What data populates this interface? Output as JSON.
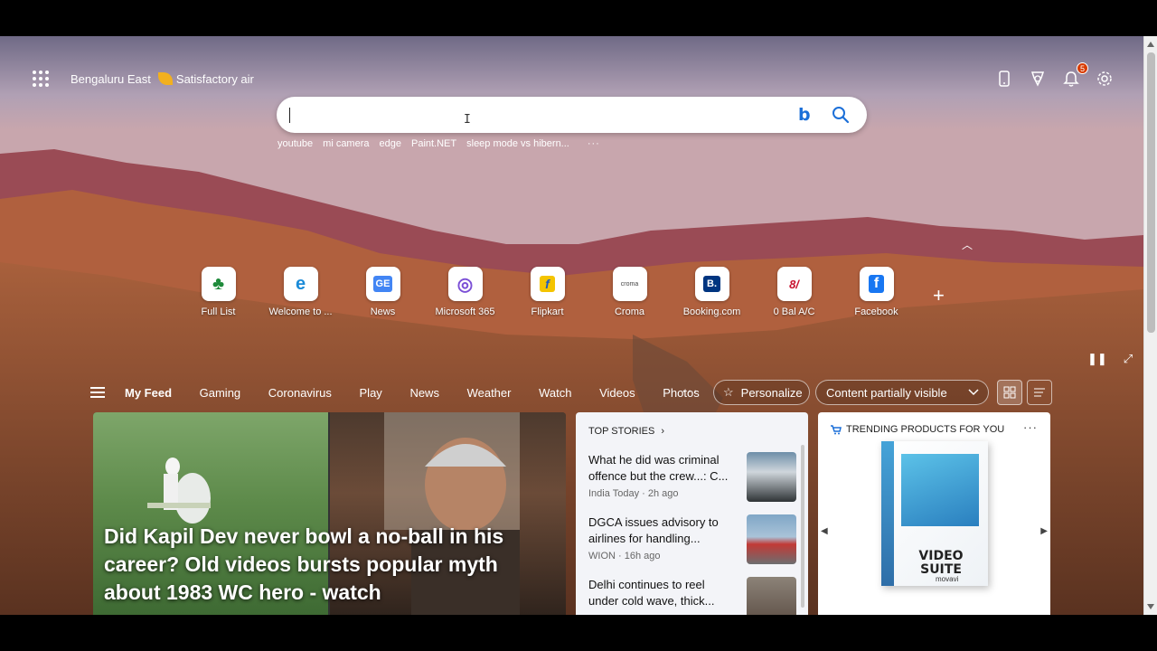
{
  "location": "Bengaluru East",
  "air_quality": "Satisfactory air",
  "notifications_count": "5",
  "search": {
    "placeholder": "",
    "suggestions": [
      "youtube",
      "mi camera",
      "edge",
      "Paint.NET",
      "sleep mode vs hibern..."
    ]
  },
  "quick_links": [
    {
      "label": "Full List",
      "icon": "solitaire-icon",
      "glyph": "♣",
      "color": "#1e8a3a"
    },
    {
      "label": "Welcome to ...",
      "icon": "edge-icon",
      "glyph": "e",
      "color": "#1b8bd8"
    },
    {
      "label": "News",
      "icon": "google-news-icon",
      "glyph": "GE",
      "color": "#4285f4"
    },
    {
      "label": "Microsoft 365",
      "icon": "microsoft-365-icon",
      "glyph": "◎",
      "color": "#7b4fd6"
    },
    {
      "label": "Flipkart",
      "icon": "flipkart-icon",
      "glyph": "f",
      "color": "#f4c400"
    },
    {
      "label": "Croma",
      "icon": "croma-icon",
      "glyph": "croma",
      "color": "#444444"
    },
    {
      "label": "Booking.com",
      "icon": "booking-icon",
      "glyph": "B.",
      "color": "#003580"
    },
    {
      "label": "0 Bal A/C",
      "icon": "bank-icon",
      "glyph": "8/",
      "color": "#c8102e"
    },
    {
      "label": "Facebook",
      "icon": "facebook-icon",
      "glyph": "f",
      "color": "#1877f2"
    }
  ],
  "feed_nav": [
    "My Feed",
    "Gaming",
    "Coronavirus",
    "Play",
    "News",
    "Weather",
    "Watch",
    "Videos",
    "Photos"
  ],
  "personalize_label": "Personalize",
  "content_visibility": "Content partially visible",
  "hero": {
    "title": "Did Kapil Dev never bowl a no-ball in his career? Old videos bursts popular myth about 1983 WC hero - watch"
  },
  "top_stories": {
    "header": "TOP STORIES",
    "items": [
      {
        "title": "What he did was criminal offence but the crew...: C...",
        "meta": "India Today · 2h ago"
      },
      {
        "title": "DGCA issues advisory to airlines for handling...",
        "meta": "WION · 16h ago"
      },
      {
        "title": "Delhi continues to reel under cold wave, thick...",
        "meta": ""
      }
    ]
  },
  "trending": {
    "header": "TRENDING PRODUCTS FOR YOU",
    "product_title": "VIDEO SUITE",
    "product_brand": "movavi"
  }
}
